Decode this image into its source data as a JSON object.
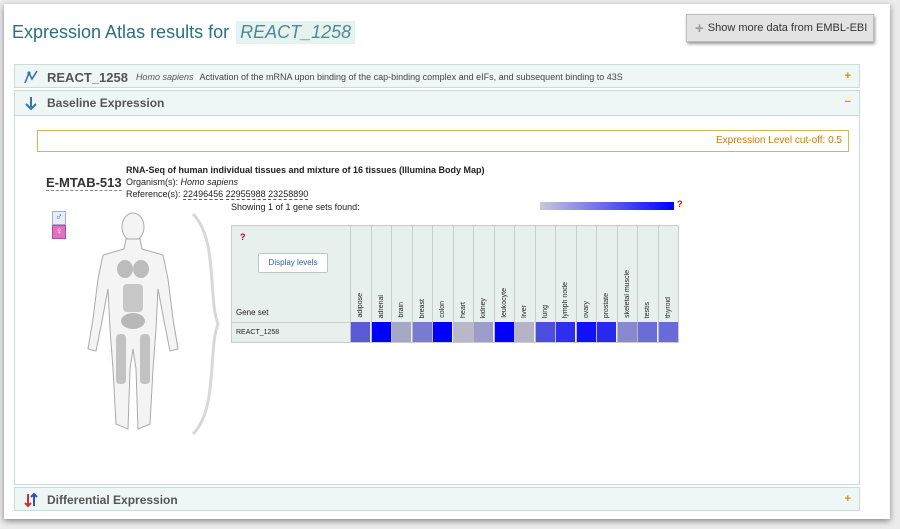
{
  "header": {
    "title_prefix": "Expression Atlas results for",
    "query": "REACT_1258",
    "ebi_button": "Show more data from EMBL-EBI"
  },
  "react_section": {
    "id": "REACT_1258",
    "species": "Homo sapiens",
    "description": "Activation of the mRNA upon binding of the cap-binding complex and eIFs, and subsequent binding to 43S",
    "toggle": "+"
  },
  "baseline": {
    "title": "Baseline Expression",
    "toggle": "−",
    "cutoff_label": "Expression Level cut-off: 0.5",
    "experiment": {
      "accession": "E-MTAB-513",
      "title": "RNA-Seq of human individual tissues and mixture of 16 tissues (Illumina Body Map)",
      "organism_label": "Organism(s):",
      "organism": "Homo sapiens",
      "reference_label": "Reference(s):",
      "references": [
        "22496456",
        "22955988",
        "23258890"
      ]
    },
    "showing": "Showing 1 of 1 gene sets found:",
    "legend_help": "?",
    "heatmap": {
      "help": "?",
      "display_button": "Display levels",
      "gene_set_header": "Gene set",
      "row_label": "REACT_1258",
      "columns": [
        "adipose",
        "adrenal",
        "brain",
        "breast",
        "colon",
        "heart",
        "kidney",
        "leukocyte",
        "liver",
        "lung",
        "lymph node",
        "ovary",
        "prostate",
        "skeletal muscle",
        "testis",
        "thyroid"
      ],
      "colors": [
        "#5a5ad4",
        "#0000ff",
        "#a6a6c6",
        "#7a7ad0",
        "#0000ff",
        "#b8b8c8",
        "#9d9dcc",
        "#0000ff",
        "#b4b4c6",
        "#4c4ce0",
        "#2e2ef0",
        "#1010fa",
        "#2828ee",
        "#8888ce",
        "#6c6cd6",
        "#6a6ad8"
      ]
    }
  },
  "differential": {
    "title": "Differential Expression",
    "toggle": "+"
  },
  "colors": {
    "accent": "#2a6f82",
    "section_bg": "#eef7f5",
    "cutoff": "#d07a00"
  }
}
